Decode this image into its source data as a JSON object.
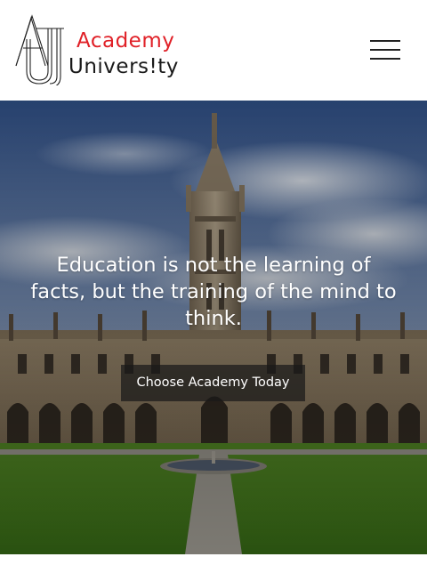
{
  "header": {
    "logo": {
      "line1": "Academy",
      "line2": "Univers!ty",
      "line1_color": "#e02027",
      "line2_color": "#1a1a1a",
      "mark_icon": "academy-monogram-logo"
    },
    "menu_icon": "hamburger-menu-icon"
  },
  "hero": {
    "background": "university-quadrangle-photo",
    "quote": "Education is not the learning of facts, but the training of the mind to think.",
    "cta_label": "Choose Academy Today"
  },
  "colors": {
    "accent": "#e02027",
    "header_bg": "#ffffff",
    "overlay_text": "#ffffff",
    "cta_bg": "#191919"
  }
}
